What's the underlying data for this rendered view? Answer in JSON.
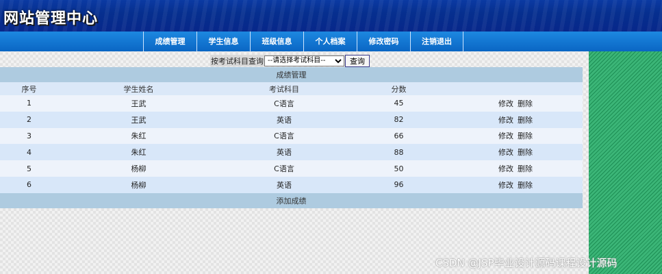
{
  "header": {
    "title": "网站管理中心"
  },
  "nav": {
    "items": [
      {
        "label": "成绩管理"
      },
      {
        "label": "学生信息"
      },
      {
        "label": "班级信息"
      },
      {
        "label": "个人档案"
      },
      {
        "label": "修改密码"
      },
      {
        "label": "注销退出"
      }
    ]
  },
  "search": {
    "label": "按考试科目查询",
    "select_value": "--请选择考试科目--",
    "button_label": "查询"
  },
  "table": {
    "caption": "成绩管理",
    "columns": [
      "序号",
      "学生姓名",
      "考试科目",
      "分数",
      ""
    ],
    "rows": [
      {
        "id": "1",
        "name": "王武",
        "subject": "C语言",
        "score": "45"
      },
      {
        "id": "2",
        "name": "王武",
        "subject": "英语",
        "score": "82"
      },
      {
        "id": "3",
        "name": "朱红",
        "subject": "C语言",
        "score": "66"
      },
      {
        "id": "4",
        "name": "朱红",
        "subject": "英语",
        "score": "88"
      },
      {
        "id": "5",
        "name": "杨柳",
        "subject": "C语言",
        "score": "50"
      },
      {
        "id": "6",
        "name": "杨柳",
        "subject": "英语",
        "score": "96"
      }
    ],
    "edit_label": "修改",
    "delete_label": "删除",
    "add_label": "添加成绩"
  },
  "watermark": "CSDN @JSP毕业设计源码课程设计源码",
  "colors": {
    "header": "#062f8f",
    "navbar": "#0a66c4",
    "side_panel": "#2fa66a",
    "table_caption": "#aecbe0"
  }
}
